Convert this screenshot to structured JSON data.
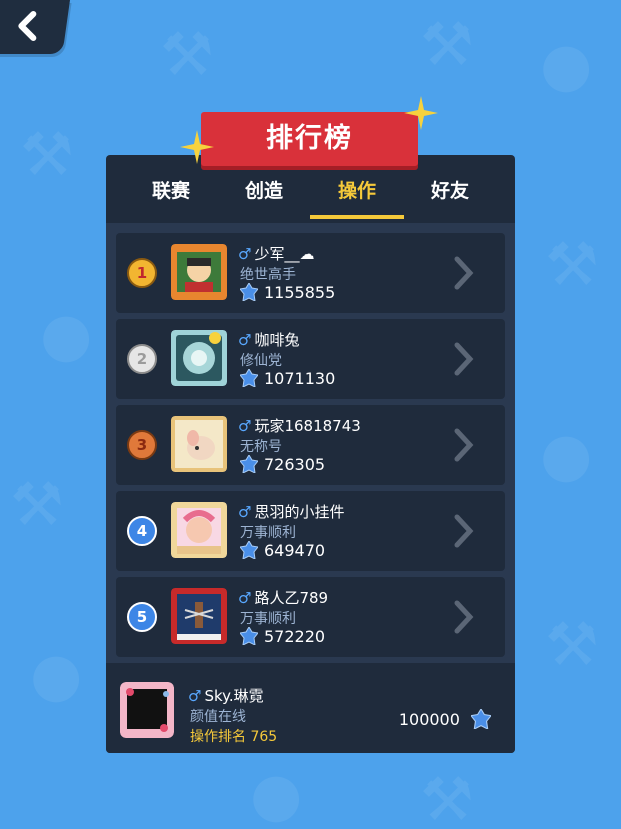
{
  "header": {
    "title": "排行榜"
  },
  "tabs": [
    {
      "label": "联赛"
    },
    {
      "label": "创造"
    },
    {
      "label": "操作",
      "active": true
    },
    {
      "label": "好友"
    }
  ],
  "leaderboard": [
    {
      "rank": "1",
      "gender": "♂",
      "name": "少军__☁",
      "title": "绝世高手",
      "score": "1155855"
    },
    {
      "rank": "2",
      "gender": "♂",
      "name": "咖啡兔",
      "title": "修仙党",
      "score": "1071130"
    },
    {
      "rank": "3",
      "gender": "♂",
      "name": "玩家16818743",
      "title": "无称号",
      "score": "726305"
    },
    {
      "rank": "4",
      "gender": "♂",
      "name": "思羽的小挂件",
      "title": "万事顺利",
      "score": "649470"
    },
    {
      "rank": "5",
      "gender": "♂",
      "name": "路人乙789",
      "title": "万事顺利",
      "score": "572220"
    }
  ],
  "me": {
    "gender": "♂",
    "name": "Sky.琳霓",
    "title": "颜值在线",
    "rank_text": "操作排名 765",
    "score": "100000"
  },
  "colors": {
    "background": "#4da2ec",
    "panel": "#1f2b3c",
    "accent": "#f5c93a",
    "banner": "#d9313a",
    "gem": "#4a8fe8"
  },
  "icons": {
    "back": "chevron-left-icon",
    "gem": "blue-gem-icon",
    "row_arrow": "chevron-right-icon",
    "gender": "male-icon"
  }
}
